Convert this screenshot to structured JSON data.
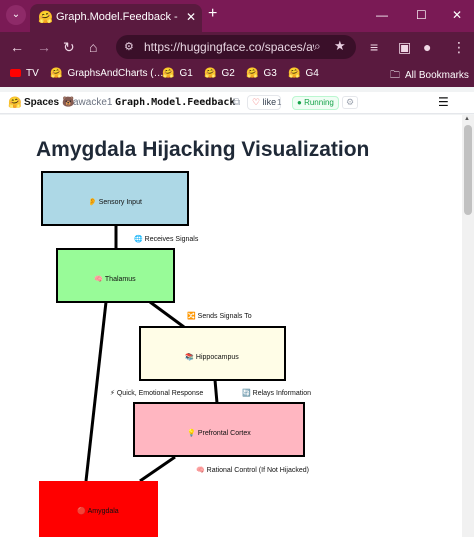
{
  "browser": {
    "tab_title": "Graph.Model.Feedback - a Hugg",
    "tab_favicon": "🤗",
    "url": "https://huggingface.co/spaces/aw…",
    "bookmarks": [
      {
        "label": "TV",
        "icon": "youtube-icon"
      },
      {
        "label": "GraphsAndCharts (…",
        "icon": "🤗"
      },
      {
        "label": "G1",
        "icon": "🤗"
      },
      {
        "label": "G2",
        "icon": "🤗"
      },
      {
        "label": "G3",
        "icon": "🤗"
      },
      {
        "label": "G4",
        "icon": "🤗"
      },
      {
        "label": "All Bookmarks",
        "icon": "folder-icon"
      }
    ]
  },
  "hf": {
    "spaces_label": "Spaces",
    "owner": "awacke1",
    "repo": "Graph.Model.Feedback",
    "like_label": "like",
    "like_count": "1",
    "status": "Running"
  },
  "page": {
    "title": "Amygdala Hijacking Visualization"
  },
  "diagram": {
    "nodes": [
      {
        "id": "sensory",
        "label": "👂 Sensory Input",
        "color": "#add8e6"
      },
      {
        "id": "thalamus",
        "label": "🧠 Thalamus",
        "color": "#98fb98"
      },
      {
        "id": "hippocampus",
        "label": "📚 Hippocampus",
        "color": "#fffde7"
      },
      {
        "id": "prefrontal",
        "label": "💡 Prefrontal Cortex",
        "color": "#ffb6c1"
      },
      {
        "id": "amygdala",
        "label": "🔴 Amygdala",
        "color": "#ff0000"
      }
    ],
    "edges": [
      {
        "label": "🌐 Receives Signals"
      },
      {
        "label": "🔀 Sends Signals To"
      },
      {
        "label": "⚡ Quick, Emotional Response"
      },
      {
        "label": "🔄 Relays Information"
      },
      {
        "label": "🧠 Rational Control (If Not Hijacked)"
      }
    ]
  }
}
